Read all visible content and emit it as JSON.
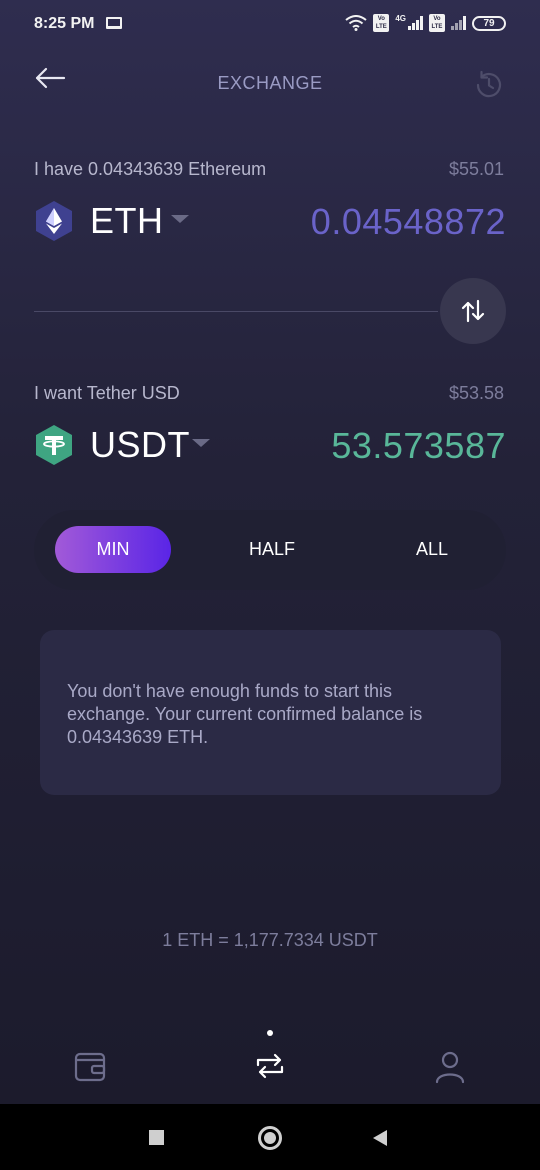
{
  "status_bar": {
    "time": "8:25 PM",
    "battery": "79",
    "network_type": "4G",
    "volte": "Vo LTE"
  },
  "header": {
    "title": "EXCHANGE"
  },
  "from": {
    "label": "I have 0.04343639 Ethereum",
    "fiat_value": "$55.01",
    "ticker": "ETH",
    "amount": "0.04548872",
    "amount_color": "#6a63c9"
  },
  "to": {
    "label": "I want Tether USD",
    "fiat_value": "$53.58",
    "ticker": "USDT",
    "amount": "53.573587",
    "amount_color": "#59b799"
  },
  "presets": {
    "min": "MIN",
    "half": "HALF",
    "all": "ALL",
    "selected": "MIN"
  },
  "notice": {
    "text": "You don't have enough funds to start this exchange. Your current confirmed balance is 0.04343639 ETH."
  },
  "rate": {
    "text": "1 ETH = 1,177.7334 USDT"
  },
  "bottom_nav": {
    "items": [
      "wallet-icon",
      "exchange-icon",
      "profile-icon"
    ],
    "active": "exchange-icon"
  },
  "colors": {
    "accent_start": "#a25ad8",
    "accent_end": "#5a25e6",
    "eth": "#4a4c9e",
    "usdt": "#3fa582"
  }
}
